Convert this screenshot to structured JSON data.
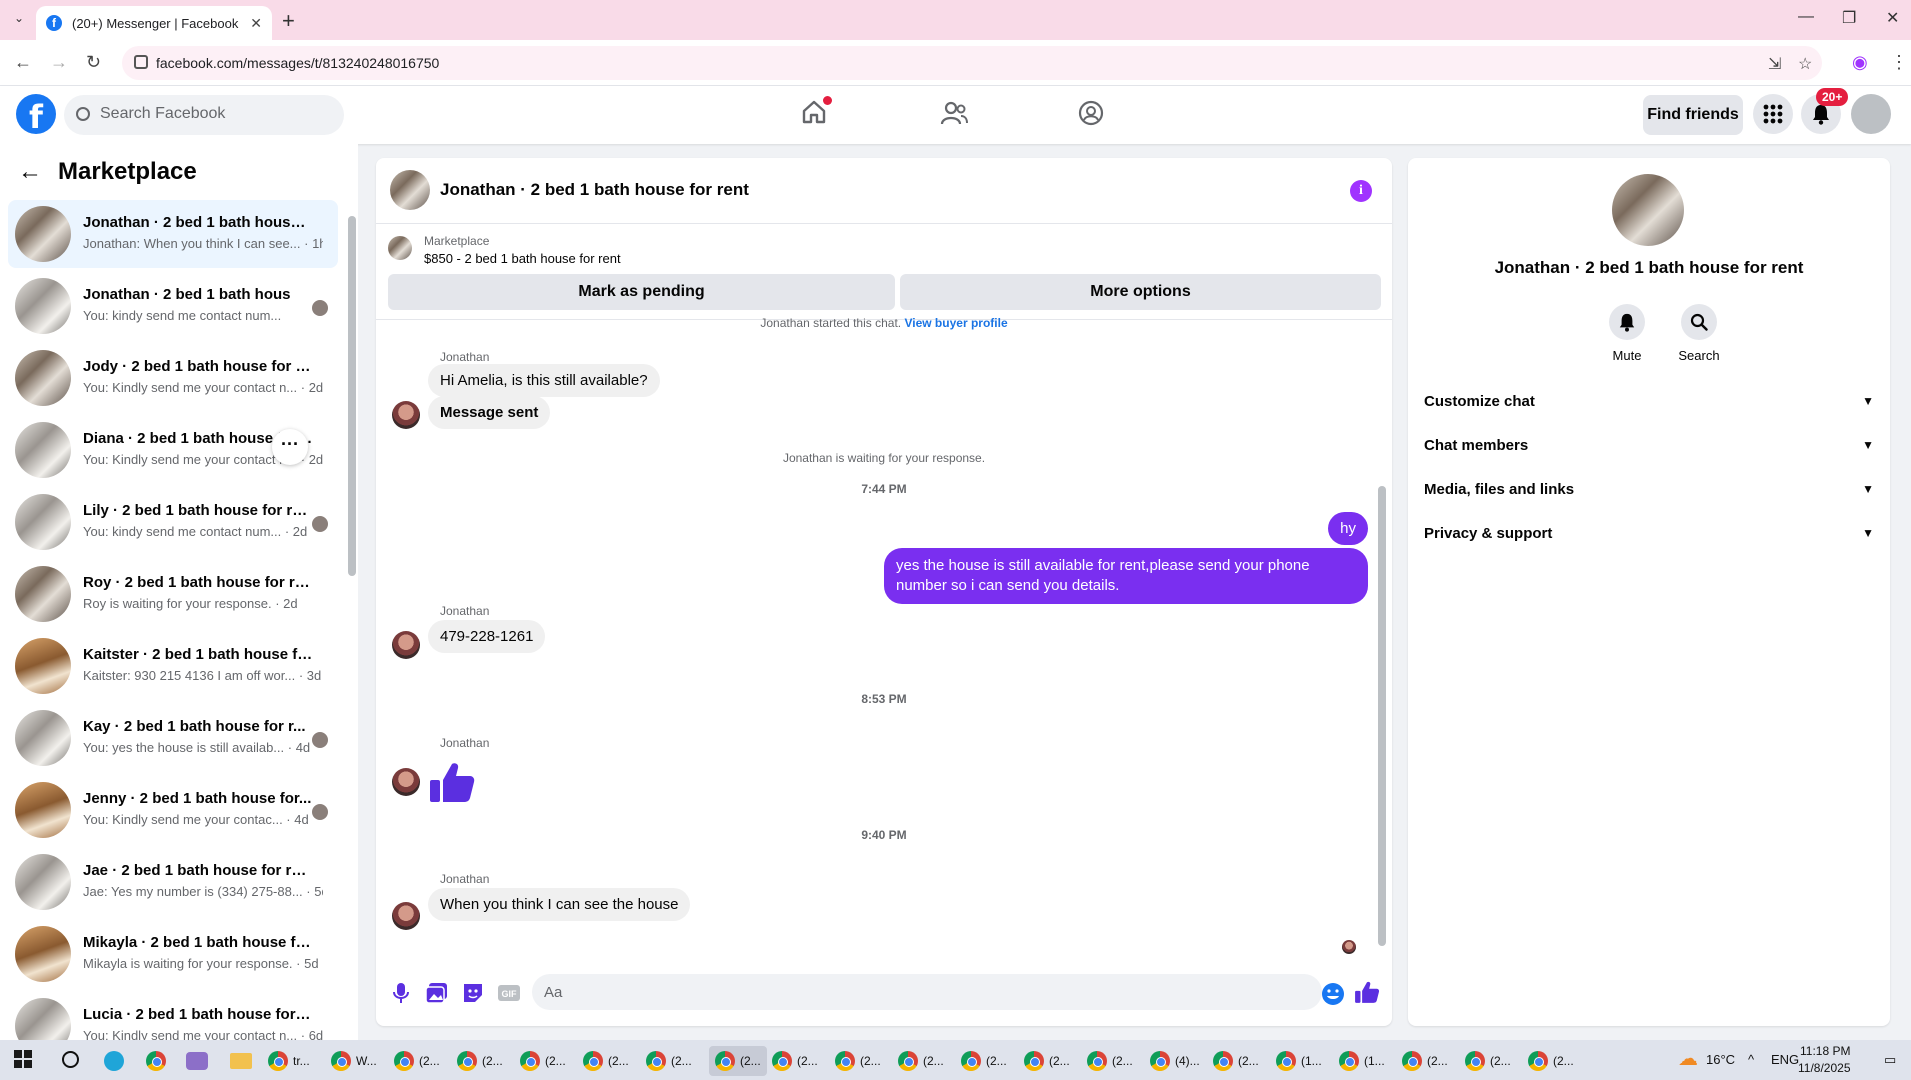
{
  "browser": {
    "tab_title": "(20+) Messenger | Facebook",
    "url": "facebook.com/messages/t/813240248016750"
  },
  "header": {
    "search_placeholder": "Search Facebook",
    "find_friends": "Find friends",
    "notif_count": "20+"
  },
  "sidebar": {
    "title": "Marketplace",
    "conversations": [
      {
        "name": "Jonathan · 2 bed 1 bath house f...",
        "snippet": "Jonathan: When you think I can see... · 1h",
        "thumb": "photo"
      },
      {
        "name": "Jonathan · 2 bed 1 bath hous",
        "snippet": "You: kindy send me contact num...",
        "thumb": "photo2"
      },
      {
        "name": "Jody · 2 bed 1 bath house for rent",
        "snippet": "You: Kindly send me your contact n... · 2d",
        "thumb": "photo"
      },
      {
        "name": "Diana · 2 bed 1 bath house for r...",
        "snippet": "You: Kindly send me your contact n... · 2d",
        "thumb": "photo2"
      },
      {
        "name": "Lily · 2 bed 1 bath house for re...",
        "snippet": "You: kindy send me contact num... · 2d",
        "thumb": "photo2"
      },
      {
        "name": "Roy · 2 bed 1 bath house for rent",
        "snippet": "Roy is waiting for your response. · 2d",
        "thumb": "photo"
      },
      {
        "name": "Kaitster · 2 bed 1 bath house for ...",
        "snippet": "Kaitster: 930 215 4136 I am off wor... · 3d",
        "thumb": "photo3"
      },
      {
        "name": "Kay · 2 bed 1 bath house for r...",
        "snippet": "You: yes the house is still availab... · 4d",
        "thumb": "photo2"
      },
      {
        "name": "Jenny · 2 bed 1 bath house for...",
        "snippet": "You: Kindly send me your contac... · 4d",
        "thumb": "photo3"
      },
      {
        "name": "Jae · 2 bed 1 bath house for rent",
        "snippet": "Jae: Yes my number is (334) 275-88... · 5d",
        "thumb": "photo2"
      },
      {
        "name": "Mikayla · 2 bed 1 bath house for...",
        "snippet": "Mikayla is waiting for your response. · 5d",
        "thumb": "photo3"
      },
      {
        "name": "Lucia · 2 bed 1 bath house for rent",
        "snippet": "You: Kindly send me your contact n... · 6d",
        "thumb": "photo2"
      }
    ]
  },
  "chat": {
    "title": "Jonathan · 2 bed 1 bath house for rent",
    "marketplace_label": "Marketplace",
    "listing": "$850 - 2 bed 1 bath house for rent",
    "mark_pending": "Mark as pending",
    "more_options": "More options",
    "started_text": "Jonathan started this chat.",
    "view_profile": "View buyer profile",
    "sender": "Jonathan",
    "msg1": "Hi Amelia, is this still available?",
    "msg2": "Message sent",
    "waiting": "Jonathan is waiting for your response.",
    "time1": "7:44 PM",
    "out1": "hy",
    "out2": "yes the house is still available for rent,please send your phone number so i can send you details.",
    "msg3": "479-228-1261",
    "time2": "8:53 PM",
    "time3": "9:40 PM",
    "msg4": "When you think I can see the house",
    "composer_placeholder": "Aa"
  },
  "details": {
    "title": "Jonathan · 2 bed 1 bath house for rent",
    "mute": "Mute",
    "search": "Search",
    "sections": [
      "Customize chat",
      "Chat members",
      "Media, files and links",
      "Privacy & support"
    ]
  },
  "taskbar": {
    "apps": [
      "tr...",
      "W...",
      "(2...",
      "(2...",
      "(2...",
      "(2...",
      "(2...",
      "(2...",
      "(2...",
      "(2...",
      "(2...",
      "(2...",
      "(2...",
      "(2...",
      "(4)...",
      "(2...",
      "(1...",
      "(1...",
      "(2...",
      "(2...",
      "(2..."
    ],
    "temp": "16°C",
    "lang": "ENG",
    "time": "11:18 PM",
    "date": "11/8/2025"
  }
}
